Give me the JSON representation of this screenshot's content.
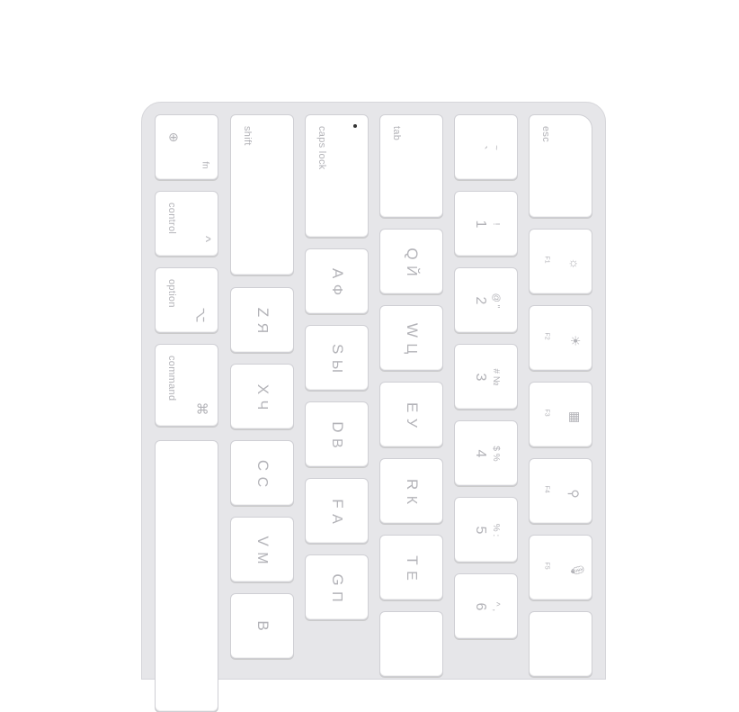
{
  "keyboard": {
    "modifiers": {
      "fn": "fn",
      "globe_icon": "globe-icon",
      "control": "control",
      "control_symbol": "^",
      "option": "option",
      "option_symbol": "⌥",
      "command": "command",
      "command_symbol": "⌘",
      "shift": "shift",
      "caps_lock": "caps lock",
      "tab": "tab",
      "esc": "esc"
    },
    "number_row": [
      {
        "main": "~",
        "sub": "`"
      },
      {
        "main": "!",
        "sub": "1"
      },
      {
        "main": "@ \"",
        "sub": "2"
      },
      {
        "main": "# №",
        "sub": "3"
      },
      {
        "main": "$ %",
        "sub": "4"
      },
      {
        "main": "% :",
        "sub": "5"
      },
      {
        "main": "^ ,",
        "sub": "6"
      }
    ],
    "fkeys": [
      {
        "label": "F1",
        "icon": "☼"
      },
      {
        "label": "F2",
        "icon": "☀"
      },
      {
        "label": "F3",
        "icon": "▦"
      },
      {
        "label": "F4",
        "icon": "⚲"
      },
      {
        "label": "F5",
        "icon": "🎙"
      }
    ],
    "row_q": [
      {
        "main": "Q",
        "cyr": "Й"
      },
      {
        "main": "W",
        "cyr": "Ц"
      },
      {
        "main": "E",
        "cyr": "У"
      },
      {
        "main": "R",
        "cyr": "К"
      },
      {
        "main": "T",
        "cyr": "Е"
      }
    ],
    "row_a": [
      {
        "main": "A",
        "cyr": "Ф"
      },
      {
        "main": "S",
        "cyr": "Ы"
      },
      {
        "main": "D",
        "cyr": "В"
      },
      {
        "main": "F",
        "cyr": "А"
      },
      {
        "main": "G",
        "cyr": "П"
      }
    ],
    "row_z": [
      {
        "main": "Z",
        "cyr": "Я"
      },
      {
        "main": "X",
        "cyr": "Ч"
      },
      {
        "main": "C",
        "cyr": "С"
      },
      {
        "main": "V",
        "cyr": "М"
      },
      {
        "main": "B",
        "cyr": ""
      }
    ]
  }
}
